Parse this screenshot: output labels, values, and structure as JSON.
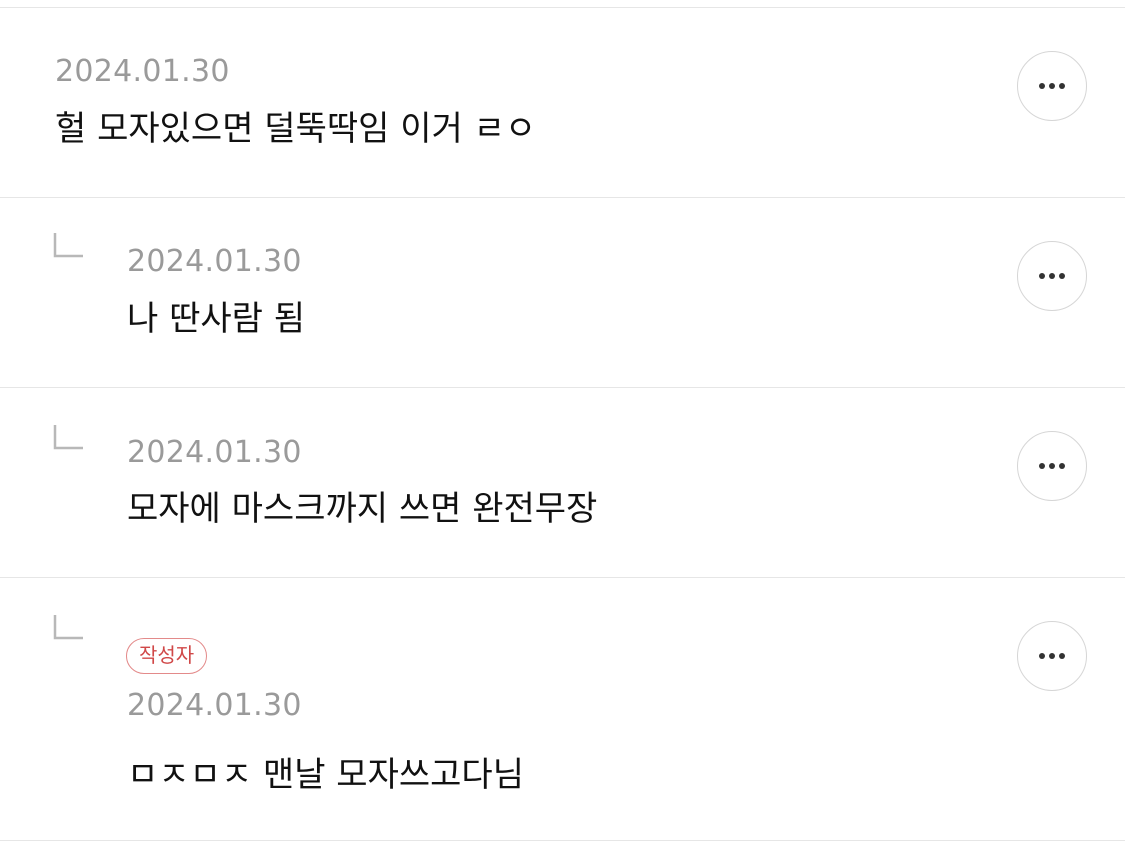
{
  "comments": [
    {
      "is_reply": false,
      "date": "2024.01.30",
      "text": "헐 모자있으면 덜뚝딱임 이거 ㄹㅇ",
      "more_icon": "ellipsis-icon"
    },
    {
      "is_reply": true,
      "date": "2024.01.30",
      "text": "나 딴사람 됨",
      "more_icon": "ellipsis-icon"
    },
    {
      "is_reply": true,
      "date": "2024.01.30",
      "text": "모자에 마스크까지 쓰면 완전무장",
      "more_icon": "ellipsis-icon"
    },
    {
      "is_reply": true,
      "badge": "작성자",
      "date": "2024.01.30",
      "text": "ㅁㅈㅁㅈ 맨날 모자쓰고다님",
      "more_icon": "ellipsis-icon"
    }
  ],
  "colors": {
    "date": "#9a9a9a",
    "text": "#111111",
    "divider": "#e6e6e6",
    "badge": "#d04848"
  }
}
